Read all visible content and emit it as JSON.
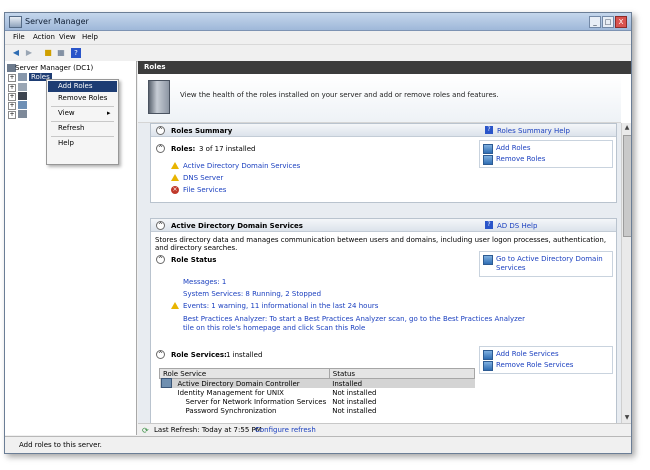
{
  "window": {
    "title": "Server Manager"
  },
  "title_buttons": {
    "minimize": "_",
    "maximize": "□",
    "close": "X"
  },
  "menu": [
    "File",
    "Action",
    "View",
    "Help"
  ],
  "tree": {
    "root": "Server Manager (DC1)",
    "selected": "Roles"
  },
  "context_menu": {
    "items": [
      "Add Roles",
      "Remove Roles",
      "View",
      "Refresh",
      "Help"
    ],
    "submenu_arrow": "▸"
  },
  "main": {
    "header": "Roles",
    "intro": "View the health of the roles installed on your server and add or remove roles and features.",
    "roles_summary": {
      "title": "Roles Summary",
      "help": "Roles Summary Help",
      "roles_label": "Roles:",
      "roles_count": "3 of 17 installed",
      "roles": [
        "Active Directory Domain Services",
        "DNS Server",
        "File Services"
      ],
      "actions": [
        "Add Roles",
        "Remove Roles"
      ]
    },
    "adds": {
      "title": "Active Directory Domain Services",
      "help": "AD DS Help",
      "description": "Stores directory data and manages communication between users and domains, including user logon processes, authentication, and directory searches.",
      "role_status_title": "Role Status",
      "goto_link_line1": "Go to Active Directory Domain",
      "goto_link_line2": "Services",
      "messages": "Messages: 1",
      "system_services": "System Services: 8 Running, 2 Stopped",
      "events": "Events: 1 warning, 11 informational in the last 24 hours",
      "bpa_line1": "Best Practices Analyzer: To start a Best Practices Analyzer scan, go to the Best Practices Analyzer",
      "bpa_line2": "tile on this role's homepage and click Scan this Role",
      "role_services_title": "Role Services:",
      "role_services_count": "1 installed",
      "role_services_actions": [
        "Add Role Services",
        "Remove Role Services"
      ],
      "table_headers": [
        "Role Service",
        "Status"
      ],
      "table_rows": [
        [
          "Active Directory Domain Controller",
          "Installed"
        ],
        [
          "Identity Management for UNIX",
          "Not installed"
        ],
        [
          "Server for Network Information Services",
          "Not installed"
        ],
        [
          "Password Synchronization",
          "Not installed"
        ]
      ]
    },
    "bottom": {
      "last_refresh": "Last Refresh: Today at 7:55 PM",
      "configure": "Configure refresh"
    }
  },
  "status_bar": "Add roles to this server.",
  "colors": {
    "link": "#1a3fbf",
    "header_dark": "#3c3c3c",
    "menu_highlight": "#1d3c73",
    "warning": "#e8b400",
    "error": "#c0392b"
  }
}
